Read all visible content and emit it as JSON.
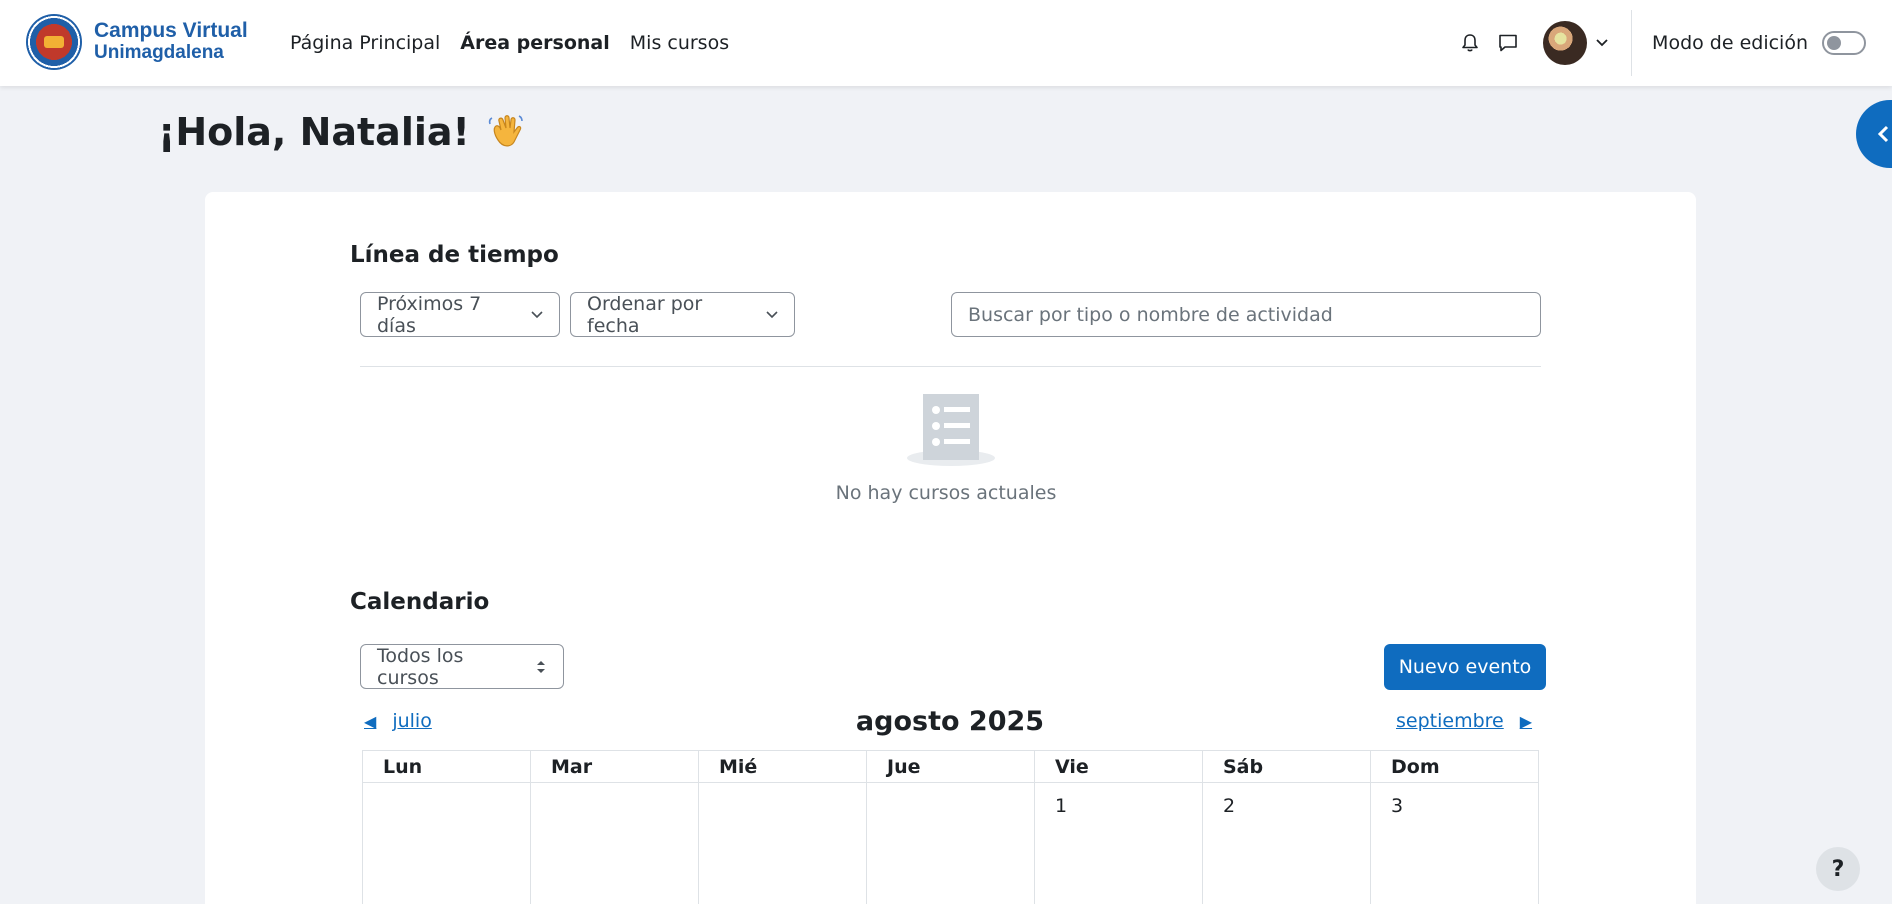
{
  "brand": {
    "line1": "Campus Virtual",
    "line2": "Unimagdalena",
    "seal_text": "UNIVERSIDAD DEL MAGDALENA"
  },
  "nav": {
    "items": [
      {
        "label": "Página Principal",
        "active": false
      },
      {
        "label": "Área personal",
        "active": true
      },
      {
        "label": "Mis cursos",
        "active": false
      }
    ]
  },
  "header": {
    "edit_mode_label": "Modo de edición",
    "edit_mode_on": false
  },
  "greeting": "¡Hola, Natalia!",
  "timeline": {
    "title": "Línea de tiempo",
    "filter_label": "Próximos 7 días",
    "sort_label": "Ordenar por fecha",
    "search_placeholder": "Buscar por tipo o nombre de actividad",
    "empty_text": "No hay cursos actuales"
  },
  "calendar": {
    "title": "Calendario",
    "course_filter": "Todos los cursos",
    "new_event_label": "Nuevo evento",
    "prev_month": "julio",
    "next_month": "septiembre",
    "month_title": "agosto 2025",
    "weekdays": [
      "Lun",
      "Mar",
      "Mié",
      "Jue",
      "Vie",
      "Sáb",
      "Dom"
    ],
    "first_week": [
      "",
      "",
      "",
      "",
      "1",
      "2",
      "3"
    ]
  },
  "help_label": "?",
  "colors": {
    "primary": "#0f6cbf",
    "brand": "#1f5fa8",
    "page_bg": "#f0f2f6"
  }
}
